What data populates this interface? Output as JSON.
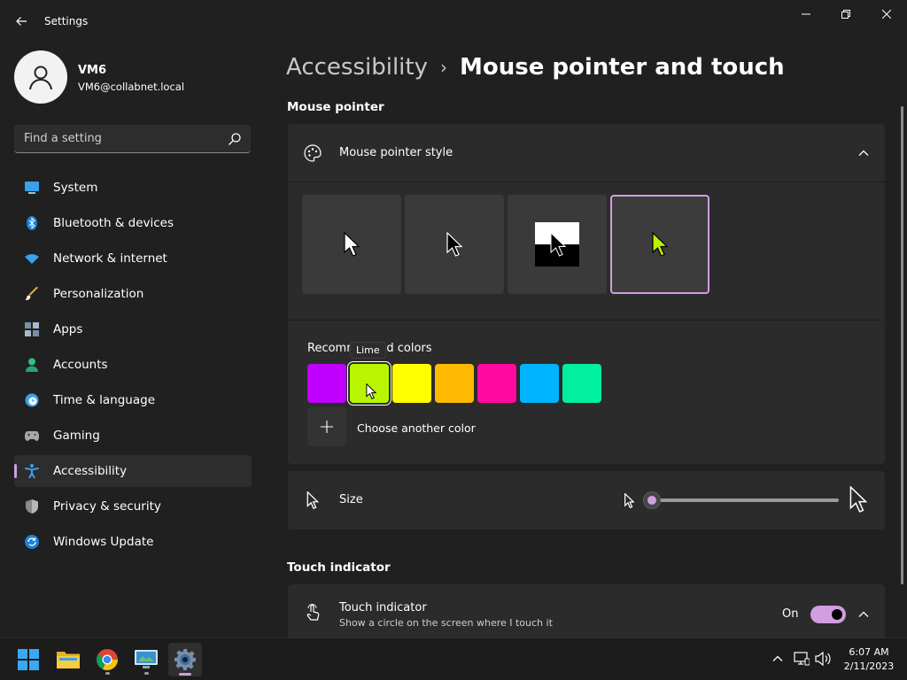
{
  "window": {
    "title": "Settings"
  },
  "profile": {
    "name": "VM6",
    "email": "VM6@collabnet.local"
  },
  "search": {
    "placeholder": "Find a setting"
  },
  "nav": {
    "items": [
      {
        "label": "System",
        "icon": "system-icon"
      },
      {
        "label": "Bluetooth & devices",
        "icon": "bluetooth-icon"
      },
      {
        "label": "Network & internet",
        "icon": "wifi-icon"
      },
      {
        "label": "Personalization",
        "icon": "brush-icon"
      },
      {
        "label": "Apps",
        "icon": "apps-icon"
      },
      {
        "label": "Accounts",
        "icon": "accounts-icon"
      },
      {
        "label": "Time & language",
        "icon": "time-language-icon"
      },
      {
        "label": "Gaming",
        "icon": "gamepad-icon"
      },
      {
        "label": "Accessibility",
        "icon": "accessibility-icon",
        "active": true
      },
      {
        "label": "Privacy & security",
        "icon": "shield-icon"
      },
      {
        "label": "Windows Update",
        "icon": "update-icon"
      }
    ]
  },
  "breadcrumb": {
    "parent": "Accessibility",
    "separator": "›",
    "current": "Mouse pointer and touch"
  },
  "mouse_pointer": {
    "section_title": "Mouse pointer",
    "style_label": "Mouse pointer style",
    "styles": [
      "white",
      "black",
      "inverted",
      "custom"
    ],
    "selected_style": "custom",
    "colors_label": "Recommended colors",
    "tooltip": "Lime",
    "colors": [
      {
        "name": "purple",
        "hex": "#bf00ff"
      },
      {
        "name": "Lime",
        "hex": "#b9f500",
        "selected": true
      },
      {
        "name": "yellow",
        "hex": "#ffff00"
      },
      {
        "name": "gold",
        "hex": "#ffb900"
      },
      {
        "name": "pink",
        "hex": "#ff0aa0"
      },
      {
        "name": "turquoise",
        "hex": "#00b4ff"
      },
      {
        "name": "green",
        "hex": "#00f0a0"
      }
    ],
    "choose_color_label": "Choose another color",
    "size_label": "Size",
    "size_value": 1
  },
  "touch": {
    "section_title": "Touch indicator",
    "label": "Touch indicator",
    "description": "Show a circle on the screen where I touch it",
    "state": "On"
  },
  "taskbar": {
    "time": "6:07 AM",
    "date": "2/11/2023"
  },
  "colors": {
    "accent": "#d19ee0",
    "background": "#202020",
    "card": "#2b2b2b"
  }
}
